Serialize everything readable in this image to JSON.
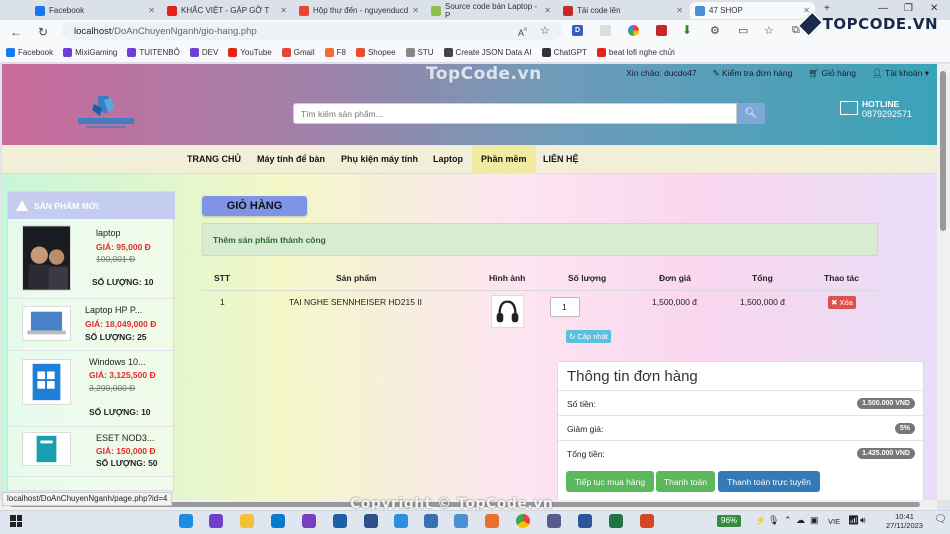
{
  "browser": {
    "tabs": [
      {
        "title": "Facebook",
        "color": "#1877f2"
      },
      {
        "title": "KHẮC VIỆT - GẶP GỠ T",
        "color": "#e62117"
      },
      {
        "title": "Hộp thư đến - nguyenducd",
        "color": "#ea4335"
      },
      {
        "title": "Source code bán Laptop - P",
        "color": "#8bc34a"
      },
      {
        "title": "Tải code lên",
        "color": "#c62828"
      },
      {
        "title": "47 SHOP",
        "color": "#4a90d9"
      }
    ],
    "new_tab": "+",
    "url_host": "localhost",
    "url_path": "/DoAnChuyenNganh/gio-hang.php",
    "bookmarks": [
      {
        "label": "Facebook",
        "color": "#1877f2"
      },
      {
        "label": "MixiGaming",
        "color": "#6a3fd8"
      },
      {
        "label": "TUITENBÔ",
        "color": "#6a3fd8"
      },
      {
        "label": "DEV",
        "color": "#6a3fd8"
      },
      {
        "label": "YouTube",
        "color": "#e62117"
      },
      {
        "label": "Gmail",
        "color": "#ea4335"
      },
      {
        "label": "F8",
        "color": "#f26b38"
      },
      {
        "label": "Shopee",
        "color": "#ee4d2d"
      },
      {
        "label": "STU",
        "color": "#888888"
      },
      {
        "label": "Create JSON Data AI",
        "color": "#444444"
      },
      {
        "label": "ChatGPT",
        "color": "#333333"
      },
      {
        "label": "beat lofi nghe chửi",
        "color": "#e62117"
      }
    ],
    "status_url": "localhost/DoAnChuyenNganh/page.php?id=4"
  },
  "watermarks": {
    "top": "TopCode.vn",
    "bottom": "Copyright © TopCode.vn",
    "corner": "TOPCODE.VN"
  },
  "header": {
    "greeting": "Xin chào: ducdo47",
    "check_order": "Kiểm tra đơn hàng",
    "cart": "Giỏ hàng",
    "account": "Tài khoản",
    "search_placeholder": "Tìm kiếm sản phẩm...",
    "hotline_label": "HOTLINE",
    "hotline_number": "0879292571"
  },
  "nav": [
    "TRANG CHỦ",
    "Máy tính để bàn",
    "Phụ kiện máy tính",
    "Laptop",
    "Phần mềm",
    "LIÊN HỆ"
  ],
  "sidebar": {
    "title": "SẢN PHẨM MỚI",
    "products": [
      {
        "name": "laptop",
        "price": "GIÁ: 95,000 Đ",
        "old_price": "100,001 Đ",
        "qty": "SỐ LƯỢNG: 10"
      },
      {
        "name": "Laptop HP P...",
        "price": "GIÁ: 18,049,000 Đ",
        "old_price": "",
        "qty": "SỐ LƯỢNG: 25"
      },
      {
        "name": "Windows 10...",
        "price": "GIÁ: 3,125,500 Đ",
        "old_price": "3,290,000 Đ",
        "qty": "SỐ LƯỢNG: 10"
      },
      {
        "name": "ESET NOD3...",
        "price": "GIÁ: 150,000 Đ",
        "old_price": "",
        "qty": "SỐ LƯỢNG: 50"
      }
    ]
  },
  "cart": {
    "title": "GIỎ HÀNG",
    "alert": "Thêm sản phẩm thành công",
    "headers": [
      "STT",
      "Sản phẩm",
      "Hình ảnh",
      "Số lượng",
      "Đơn giá",
      "Tổng",
      "Thao tác"
    ],
    "row": {
      "stt": "1",
      "name": "TAI NGHE SENNHEISER HD215 II",
      "qty": "1",
      "unit_price": "1,500,000 đ",
      "total": "1,500,000 đ",
      "delete": "Xóa"
    },
    "update": "Cập nhật"
  },
  "order": {
    "title": "Thông tin đơn hàng",
    "rows": [
      {
        "label": "Số tiền:",
        "value": "1.500.000 VND"
      },
      {
        "label": "Giảm giá:",
        "value": "5%"
      },
      {
        "label": "Tổng tiền:",
        "value": "1.425.000 VND"
      }
    ],
    "buttons": {
      "continue": "Tiếp tục mua hàng",
      "checkout": "Thanh toán",
      "online": "Thanh toán trực tuyến"
    }
  },
  "taskbar": {
    "battery": "96%",
    "lang": "VIE",
    "time": "10:41",
    "date": "27/11/2023"
  }
}
